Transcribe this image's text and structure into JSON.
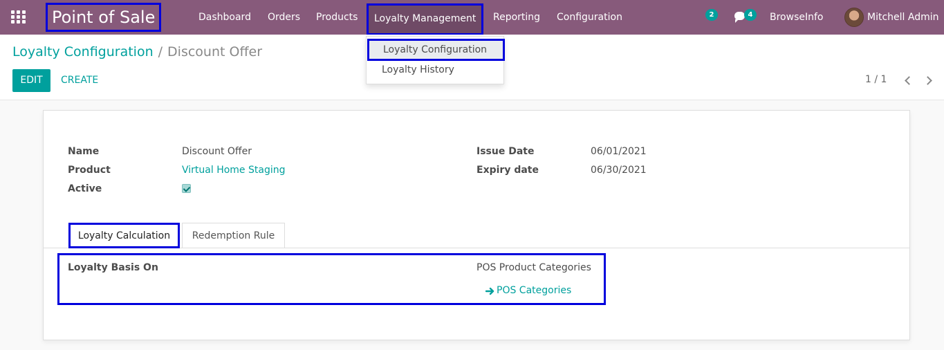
{
  "navbar": {
    "brand": "Point of Sale",
    "menu": [
      "Dashboard",
      "Orders",
      "Products",
      "Loyalty Management",
      "Reporting",
      "Configuration"
    ],
    "activities_count": "2",
    "messages_count": "4",
    "company": "BrowseInfo",
    "user": "Mitchell Admin"
  },
  "dropdown": {
    "items": [
      "Loyalty Configuration",
      "Loyalty History"
    ]
  },
  "breadcrumb": {
    "parent": "Loyalty Configuration",
    "separator": "/",
    "current": "Discount Offer"
  },
  "actions": {
    "edit": "EDIT",
    "create": "CREATE"
  },
  "pager": {
    "value": "1 / 1"
  },
  "form": {
    "name_label": "Name",
    "name_value": "Discount Offer",
    "product_label": "Product",
    "product_value": "Virtual Home Staging",
    "active_label": "Active",
    "active_value": true,
    "issue_date_label": "Issue Date",
    "issue_date_value": "06/01/2021",
    "expiry_label": "Expiry date",
    "expiry_value": "06/30/2021"
  },
  "tabs": [
    "Loyalty Calculation",
    "Redemption Rule"
  ],
  "loyalty": {
    "basis_label": "Loyalty Basis On",
    "basis_value": "POS Product Categories",
    "categories_link": "POS Categories"
  },
  "colors": {
    "navbar": "#875a7b",
    "accent": "#00a09d",
    "highlight": "#0000dd"
  }
}
